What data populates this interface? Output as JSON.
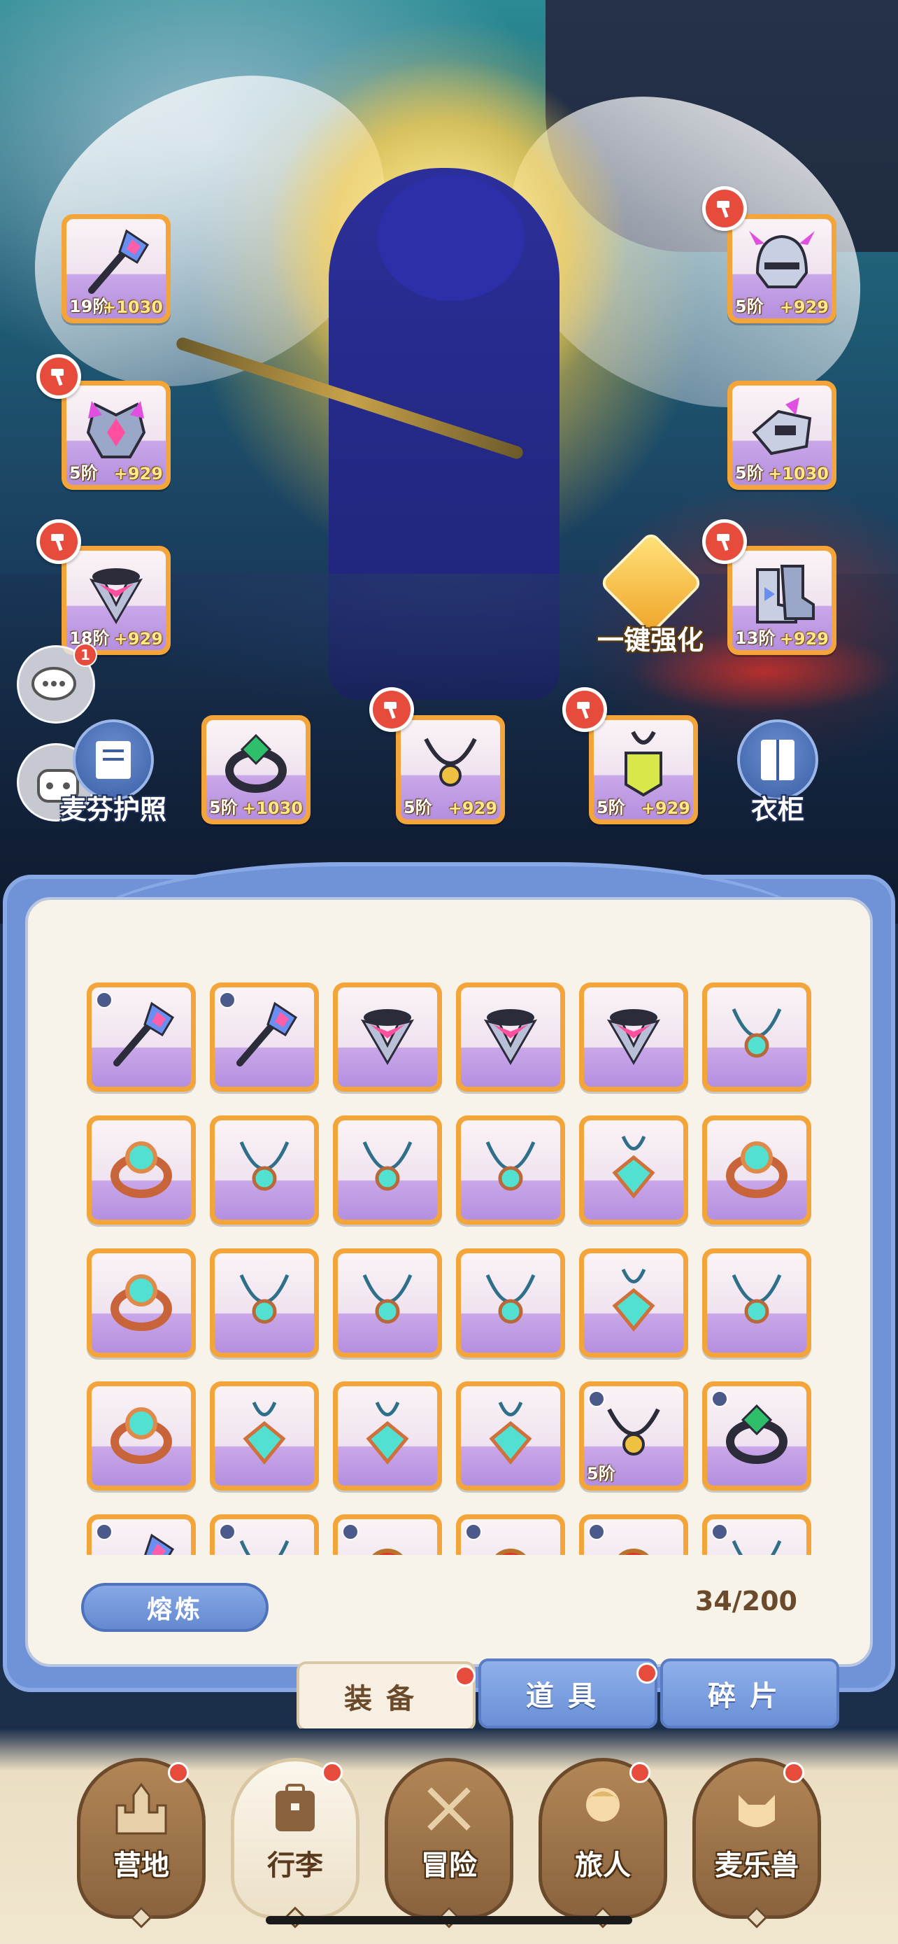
{
  "equipped": {
    "left": [
      {
        "tier": "19阶",
        "bonus": "+1030",
        "icon": "staff-icon",
        "upgradable": false
      },
      {
        "tier": "5阶",
        "bonus": "+929",
        "icon": "chest-armor-icon",
        "upgradable": true
      },
      {
        "tier": "18阶",
        "bonus": "+929",
        "icon": "belt-armor-icon",
        "upgradable": true
      }
    ],
    "right": [
      {
        "tier": "5阶",
        "bonus": "+929",
        "icon": "helmet-icon",
        "upgradable": true
      },
      {
        "tier": "5阶",
        "bonus": "+1030",
        "icon": "gauntlet-icon",
        "upgradable": false
      },
      {
        "tier": "13阶",
        "bonus": "+929",
        "icon": "boots-icon",
        "upgradable": true
      }
    ],
    "bottom": [
      {
        "tier": "5阶",
        "bonus": "+1030",
        "icon": "ring-icon",
        "upgradable": false
      },
      {
        "tier": "5阶",
        "bonus": "+929",
        "icon": "necklace-icon",
        "upgradable": true
      },
      {
        "tier": "5阶",
        "bonus": "+929",
        "icon": "amulet-icon",
        "upgradable": true
      }
    ]
  },
  "buttons": {
    "passport": "麦芬护照",
    "wardrobe": "衣柜",
    "enhance_all": "一键强化",
    "chat_badge": "1"
  },
  "bag": {
    "rows": [
      [
        {
          "icon": "staff-icon",
          "locked": true,
          "tier": ""
        },
        {
          "icon": "staff-icon",
          "locked": true,
          "tier": ""
        },
        {
          "icon": "belt-armor-icon",
          "locked": false,
          "tier": ""
        },
        {
          "icon": "belt-armor-icon",
          "locked": false,
          "tier": ""
        },
        {
          "icon": "belt-armor-icon",
          "locked": false,
          "tier": ""
        },
        {
          "icon": "necklace-icon",
          "locked": false,
          "tier": ""
        }
      ],
      [
        {
          "icon": "ring-icon",
          "locked": false,
          "tier": ""
        },
        {
          "icon": "necklace-icon",
          "locked": false,
          "tier": ""
        },
        {
          "icon": "necklace-icon",
          "locked": false,
          "tier": ""
        },
        {
          "icon": "necklace-icon",
          "locked": false,
          "tier": ""
        },
        {
          "icon": "amulet-icon",
          "locked": false,
          "tier": ""
        },
        {
          "icon": "ring-icon",
          "locked": false,
          "tier": ""
        }
      ],
      [
        {
          "icon": "ring-icon",
          "locked": false,
          "tier": ""
        },
        {
          "icon": "necklace-icon",
          "locked": false,
          "tier": ""
        },
        {
          "icon": "necklace-icon",
          "locked": false,
          "tier": ""
        },
        {
          "icon": "necklace-icon",
          "locked": false,
          "tier": ""
        },
        {
          "icon": "amulet-icon",
          "locked": false,
          "tier": ""
        },
        {
          "icon": "necklace-icon",
          "locked": false,
          "tier": ""
        }
      ],
      [
        {
          "icon": "ring-icon",
          "locked": false,
          "tier": ""
        },
        {
          "icon": "amulet-icon",
          "locked": false,
          "tier": ""
        },
        {
          "icon": "amulet-icon",
          "locked": false,
          "tier": ""
        },
        {
          "icon": "amulet-icon",
          "locked": false,
          "tier": ""
        },
        {
          "icon": "dark-necklace-icon",
          "locked": true,
          "tier": "5阶"
        },
        {
          "icon": "dark-ring-icon",
          "locked": true,
          "tier": ""
        }
      ],
      [
        {
          "icon": "staff-icon",
          "locked": true,
          "tier": ""
        },
        {
          "icon": "necklace-icon",
          "locked": true,
          "tier": ""
        },
        {
          "icon": "red-gem-icon",
          "locked": true,
          "tier": ""
        },
        {
          "icon": "red-gem-icon",
          "locked": true,
          "tier": ""
        },
        {
          "icon": "red-gem-icon",
          "locked": true,
          "tier": ""
        },
        {
          "icon": "necklace-icon",
          "locked": true,
          "tier": ""
        }
      ]
    ],
    "smelt_label": "熔炼",
    "capacity": "34/200"
  },
  "tabs": [
    {
      "label": "装备",
      "active": true
    },
    {
      "label": "道具",
      "active": false
    },
    {
      "label": "碎片",
      "active": false
    }
  ],
  "nav": [
    {
      "label": "营地",
      "icon": "castle-icon",
      "active": false
    },
    {
      "label": "行李",
      "icon": "backpack-icon",
      "active": true
    },
    {
      "label": "冒险",
      "icon": "crossed-swords-icon",
      "active": false
    },
    {
      "label": "旅人",
      "icon": "character-icon",
      "active": false
    },
    {
      "label": "麦乐兽",
      "icon": "pet-cat-icon",
      "active": false
    }
  ],
  "colors": {
    "accent": "#f3a53a",
    "panel": "#6f93d6",
    "badge": "#e64b3c"
  }
}
